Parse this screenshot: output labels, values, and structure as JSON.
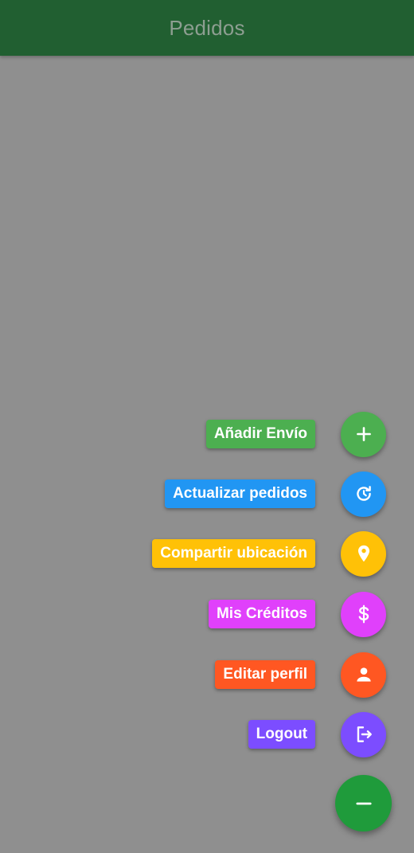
{
  "appbar": {
    "title": "Pedidos",
    "color": "#215f31",
    "title_color": "#8d9e91"
  },
  "background_color": "#8f8f8f",
  "speed_dial": {
    "actions": [
      {
        "label": "Añadir Envío",
        "icon": "plus-icon",
        "color": "#4caf50"
      },
      {
        "label": "Actualizar pedidos",
        "icon": "refresh-clock-icon",
        "color": "#2196f3"
      },
      {
        "label": "Compartir ubicación",
        "icon": "location-pin-icon",
        "color": "#ffc107"
      },
      {
        "label": "Mis Créditos",
        "icon": "dollar-icon",
        "color": "#e040fb"
      },
      {
        "label": "Editar perfil",
        "icon": "person-icon",
        "color": "#ff5722"
      },
      {
        "label": "Logout",
        "icon": "logout-icon",
        "color": "#7c4dff"
      }
    ],
    "main_button": {
      "icon": "minus-icon",
      "color": "#1f9b3b"
    }
  }
}
